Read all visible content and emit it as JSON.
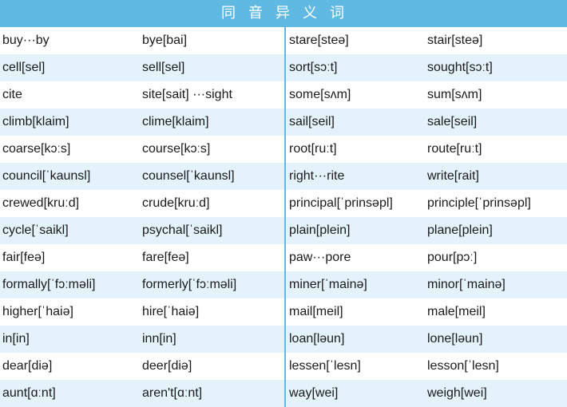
{
  "title": "同音异义词",
  "rows": [
    [
      "buy···by",
      "bye[bai]",
      "stare[steə]",
      "stair[steə]"
    ],
    [
      "cell[sel]",
      "sell[sel]",
      "sort[sɔːt]",
      "sought[sɔːt]"
    ],
    [
      "cite",
      "site[sait] ···sight",
      "some[sʌm]",
      "sum[sʌm]"
    ],
    [
      "climb[klaim]",
      "clime[klaim]",
      "sail[seil]",
      "sale[seil]"
    ],
    [
      "coarse[kɔːs]",
      "course[kɔːs]",
      "root[ruːt]",
      "route[ruːt]"
    ],
    [
      "council[ˈkaunsl]",
      "counsel[ˈkaunsl]",
      "right···rite",
      "write[rait]"
    ],
    [
      "crewed[kruːd]",
      "crude[kruːd]",
      "principal[ˈprinsəpl]",
      "principle[ˈprinsəpl]"
    ],
    [
      "cycle[ˈsaikl]",
      "psychal[ˈsaikl]",
      "plain[plein]",
      "plane[plein]"
    ],
    [
      "fair[feə]",
      "fare[feə]",
      "paw···pore",
      "pour[pɔː]"
    ],
    [
      "formally[ˈfɔːməli]",
      "formerly[ˈfɔːməli]",
      "miner[ˈmainə]",
      "minor[ˈmainə]"
    ],
    [
      "higher[ˈhaiə]",
      "hire[ˈhaiə]",
      "mail[meil]",
      "male[meil]"
    ],
    [
      "in[in]",
      "inn[in]",
      "loan[ləun]",
      "lone[ləun]"
    ],
    [
      "dear[diə]",
      "deer[diə]",
      "lessen[ˈlesn]",
      "lesson[ˈlesn]"
    ],
    [
      "aunt[ɑːnt]",
      "aren't[ɑːnt]",
      "way[wei]",
      "weigh[wei]"
    ]
  ]
}
